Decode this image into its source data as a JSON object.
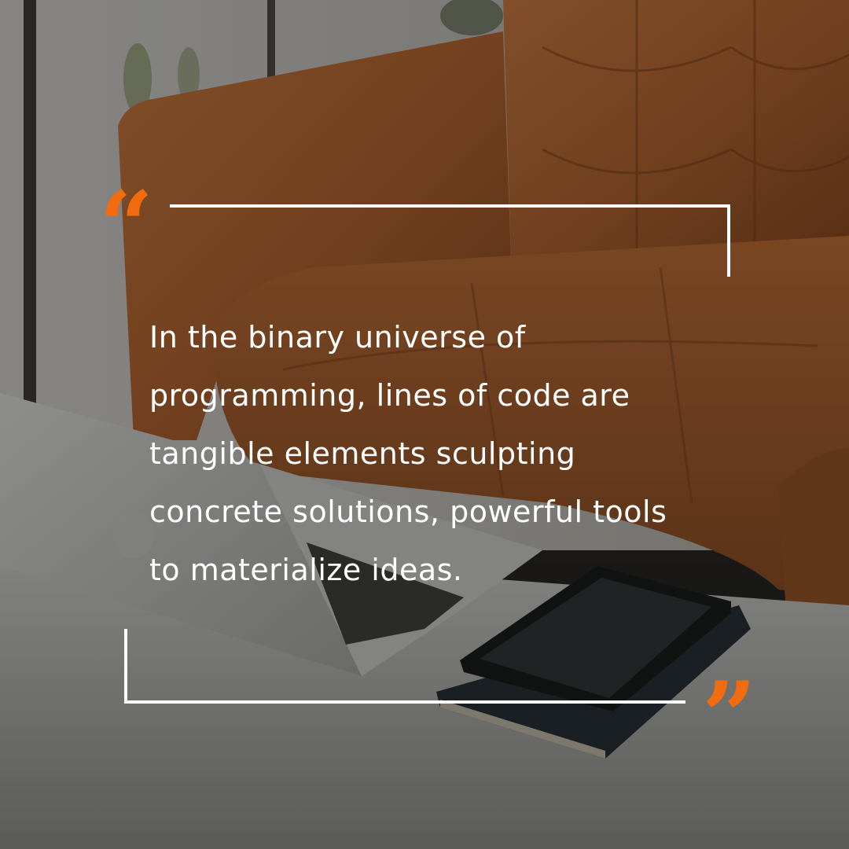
{
  "quote": {
    "text": "In the binary universe of\nprogramming, lines of code are\ntangible elements sculpting\nconcrete solutions, powerful tools\nto materialize ideas.",
    "open_mark": "“",
    "close_mark": "”"
  },
  "colors": {
    "accent": "#f26b0f",
    "text": "#ffffff",
    "frame": "#ffffff"
  },
  "background": {
    "subject": "leather-sofa-laptop-tablet-scene"
  }
}
